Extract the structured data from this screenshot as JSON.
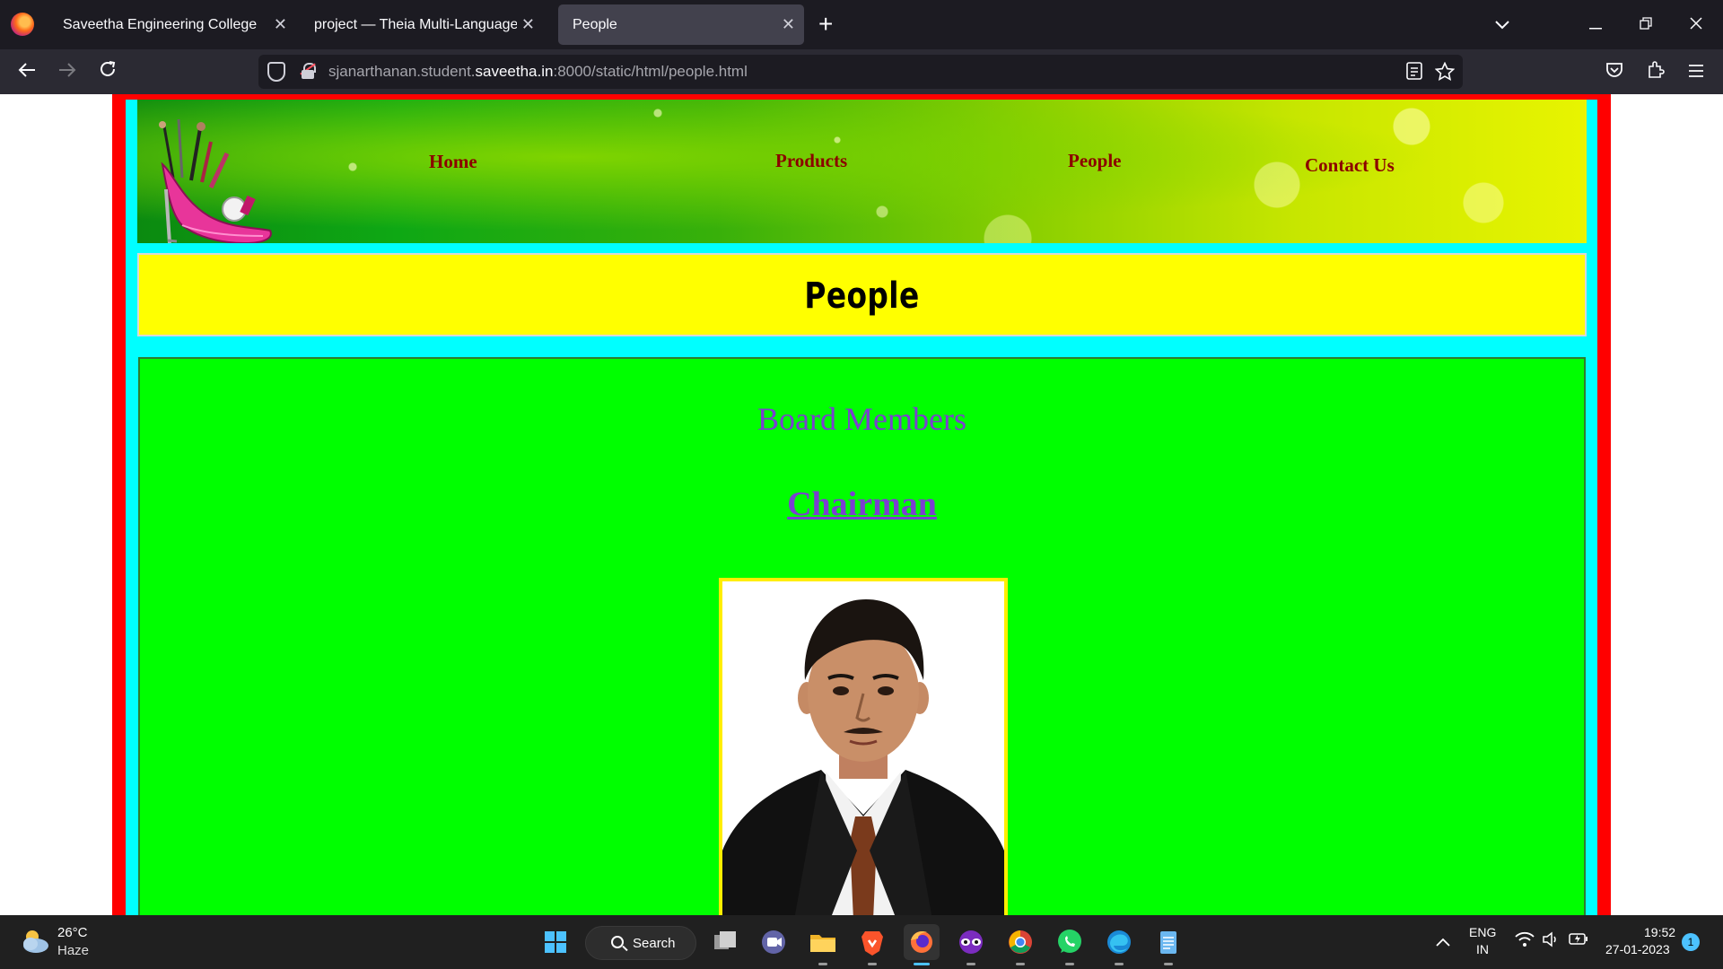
{
  "browser": {
    "tabs": [
      {
        "label": "Saveetha Engineering College",
        "close": "✕"
      },
      {
        "label": "project — Theia Multi-Language Ex",
        "close": "✕"
      },
      {
        "label": "People",
        "close": "✕"
      }
    ],
    "new_tab": "+",
    "url": {
      "prefix": "sjanarthanan.student.",
      "domain": "saveetha.in",
      "suffix": ":8000/static/html/people.html"
    },
    "icons": [
      "back-icon",
      "forward-icon",
      "reload-icon",
      "shield-icon",
      "insecure-lock-icon",
      "reader-view-icon",
      "bookmark-star-icon",
      "pocket-icon",
      "extensions-icon",
      "menu-icon"
    ]
  },
  "page": {
    "nav": {
      "home": "Home",
      "products": "Products",
      "people": "People",
      "contact": "Contact Us"
    },
    "title": "People",
    "section_title": "Board Members",
    "chairman_link": "Chairman"
  },
  "taskbar": {
    "weather": {
      "temp": "26°C",
      "condition": "Haze"
    },
    "search_label": "Search",
    "lang": {
      "line1": "ENG",
      "line2": "IN"
    },
    "clock": {
      "time": "19:52",
      "date": "27-01-2023"
    },
    "notification_count": "1",
    "apps": [
      "start-icon",
      "task-view-icon",
      "meet-icon",
      "file-explorer-icon",
      "brave-icon",
      "firefox-icon",
      "vpn-mask-icon",
      "chrome-icon",
      "whatsapp-icon",
      "edge-icon",
      "notepad-icon"
    ]
  },
  "colors": {
    "outer_frame": "#ff0000",
    "inner_frame": "#00ffff",
    "title_bg": "#ffff00",
    "content_bg": "#00ff00",
    "nav_text": "#8b0000",
    "heading_text": "#7b3fd0"
  }
}
